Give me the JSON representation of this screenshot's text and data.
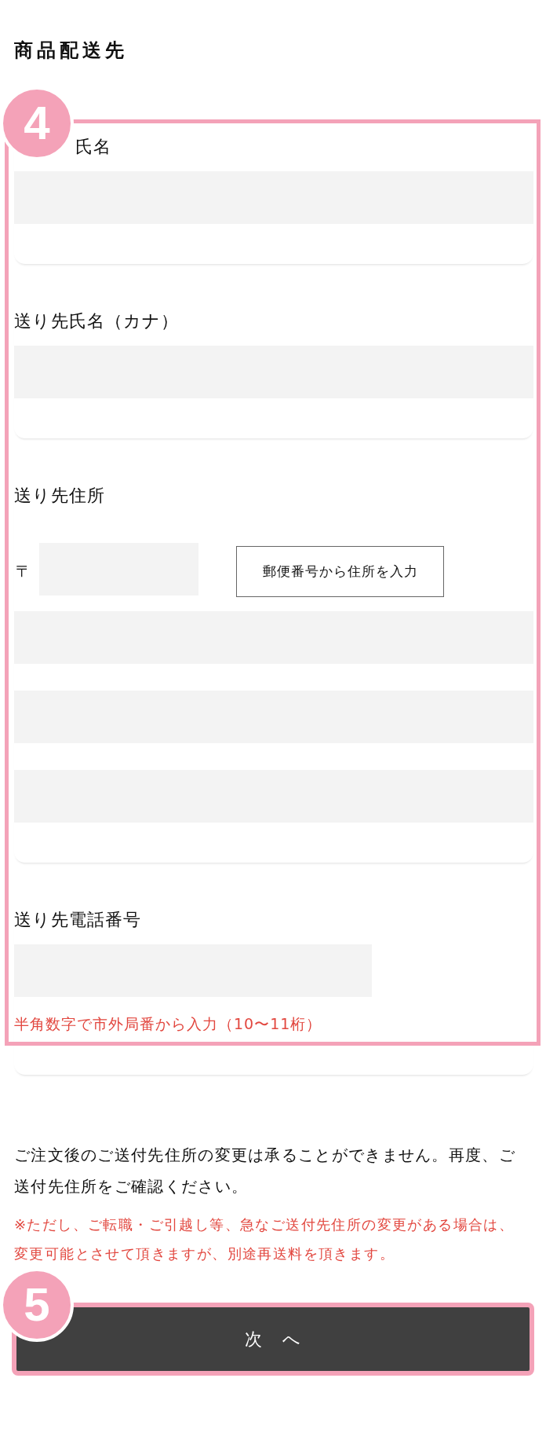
{
  "section_title": "商品配送先",
  "form": {
    "step": "4",
    "fields": [
      {
        "label": "氏名",
        "inputs": [
          {
            "kind": "wide"
          }
        ]
      },
      {
        "label": "送り先氏名（カナ）",
        "inputs": [
          {
            "kind": "wide"
          }
        ]
      },
      {
        "label": "送り先住所",
        "inputs": [
          {
            "kind": "postal",
            "mark": "〒",
            "button": "郵便番号から住所を入力"
          },
          {
            "kind": "wide"
          },
          {
            "kind": "wide"
          },
          {
            "kind": "wide"
          }
        ]
      },
      {
        "label": "送り先電話番号",
        "inputs": [
          {
            "kind": "short"
          }
        ],
        "hint": "半角数字で市外局番から入力（10〜11桁）"
      }
    ]
  },
  "notice": {
    "text": "ご注文後のご送付先住所の変更は承ることができません。再度、ご送付先住所をご確認ください。",
    "warning": "※ただし、ご転職・ご引越し等、急なご送付先住所の変更がある場合は、変更可能とさせて頂きますが、別途再送料を頂きます。"
  },
  "next_button": {
    "label": "次　へ",
    "step": "5"
  }
}
